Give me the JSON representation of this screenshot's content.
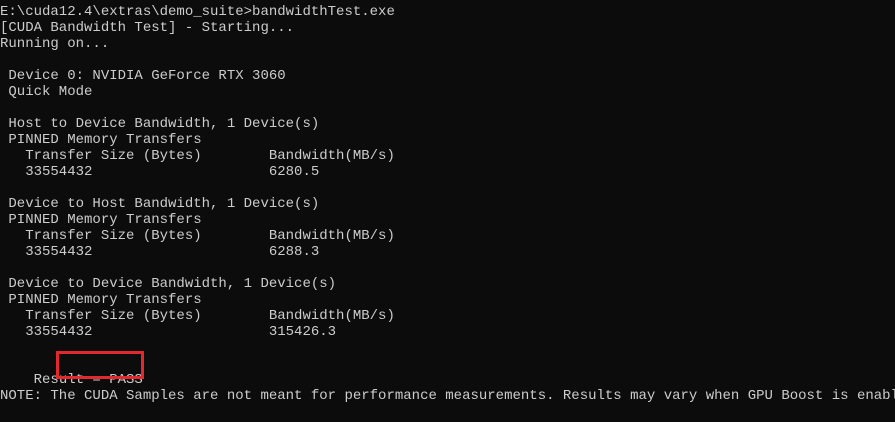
{
  "terminal": {
    "prompt_line": "E:\\cuda12.4\\extras\\demo_suite>bandwidthTest.exe",
    "starting_line": "[CUDA Bandwidth Test] - Starting...",
    "running_line": "Running on...",
    "device_line": " Device 0: NVIDIA GeForce RTX 3060",
    "mode_line": " Quick Mode",
    "sections": [
      {
        "title": " Host to Device Bandwidth, 1 Device(s)",
        "subtitle": " PINNED Memory Transfers",
        "header": "   Transfer Size (Bytes)        Bandwidth(MB/s)",
        "row": "   33554432                     6280.5"
      },
      {
        "title": " Device to Host Bandwidth, 1 Device(s)",
        "subtitle": " PINNED Memory Transfers",
        "header": "   Transfer Size (Bytes)        Bandwidth(MB/s)",
        "row": "   33554432                     6288.3"
      },
      {
        "title": " Device to Device Bandwidth, 1 Device(s)",
        "subtitle": " PINNED Memory Transfers",
        "header": "   Transfer Size (Bytes)        Bandwidth(MB/s)",
        "row": "   33554432                     315426.3"
      }
    ],
    "result_line": "Result = PASS",
    "note_line": "NOTE: The CUDA Samples are not meant for performance measurements. Results may vary when GPU Boost is enabled."
  },
  "colors": {
    "background": "#0c0c0c",
    "text": "#cccccc",
    "highlight_box": "#e3282e"
  }
}
